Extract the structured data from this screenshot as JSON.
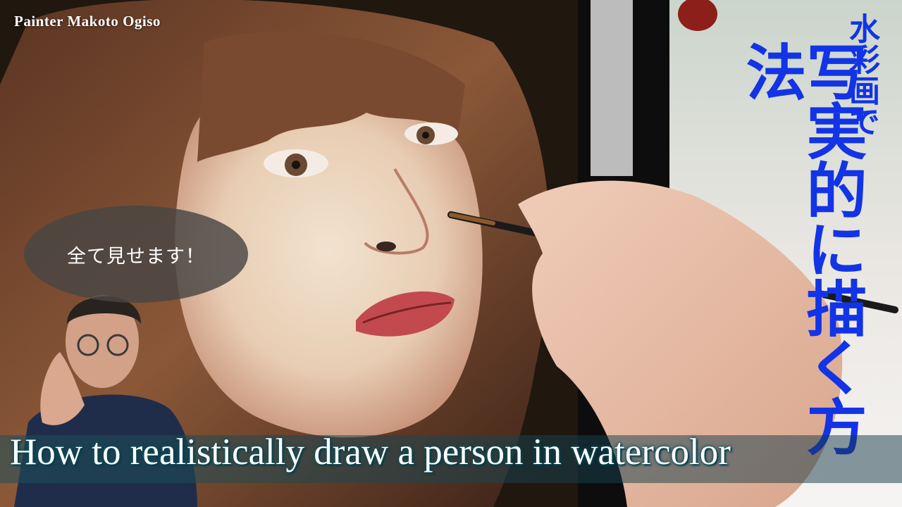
{
  "channel_name": "Painter Makoto Ogiso",
  "speech_bubble": "全て見せます！",
  "vertical_title_small": "水彩画で",
  "vertical_title_large": "写実的に描く方法",
  "caption": "How to realistically draw a person in watercolor",
  "colors": {
    "title_blue": "#1234e6",
    "caption_bar": "#1e505a",
    "bubble": "#484644"
  }
}
